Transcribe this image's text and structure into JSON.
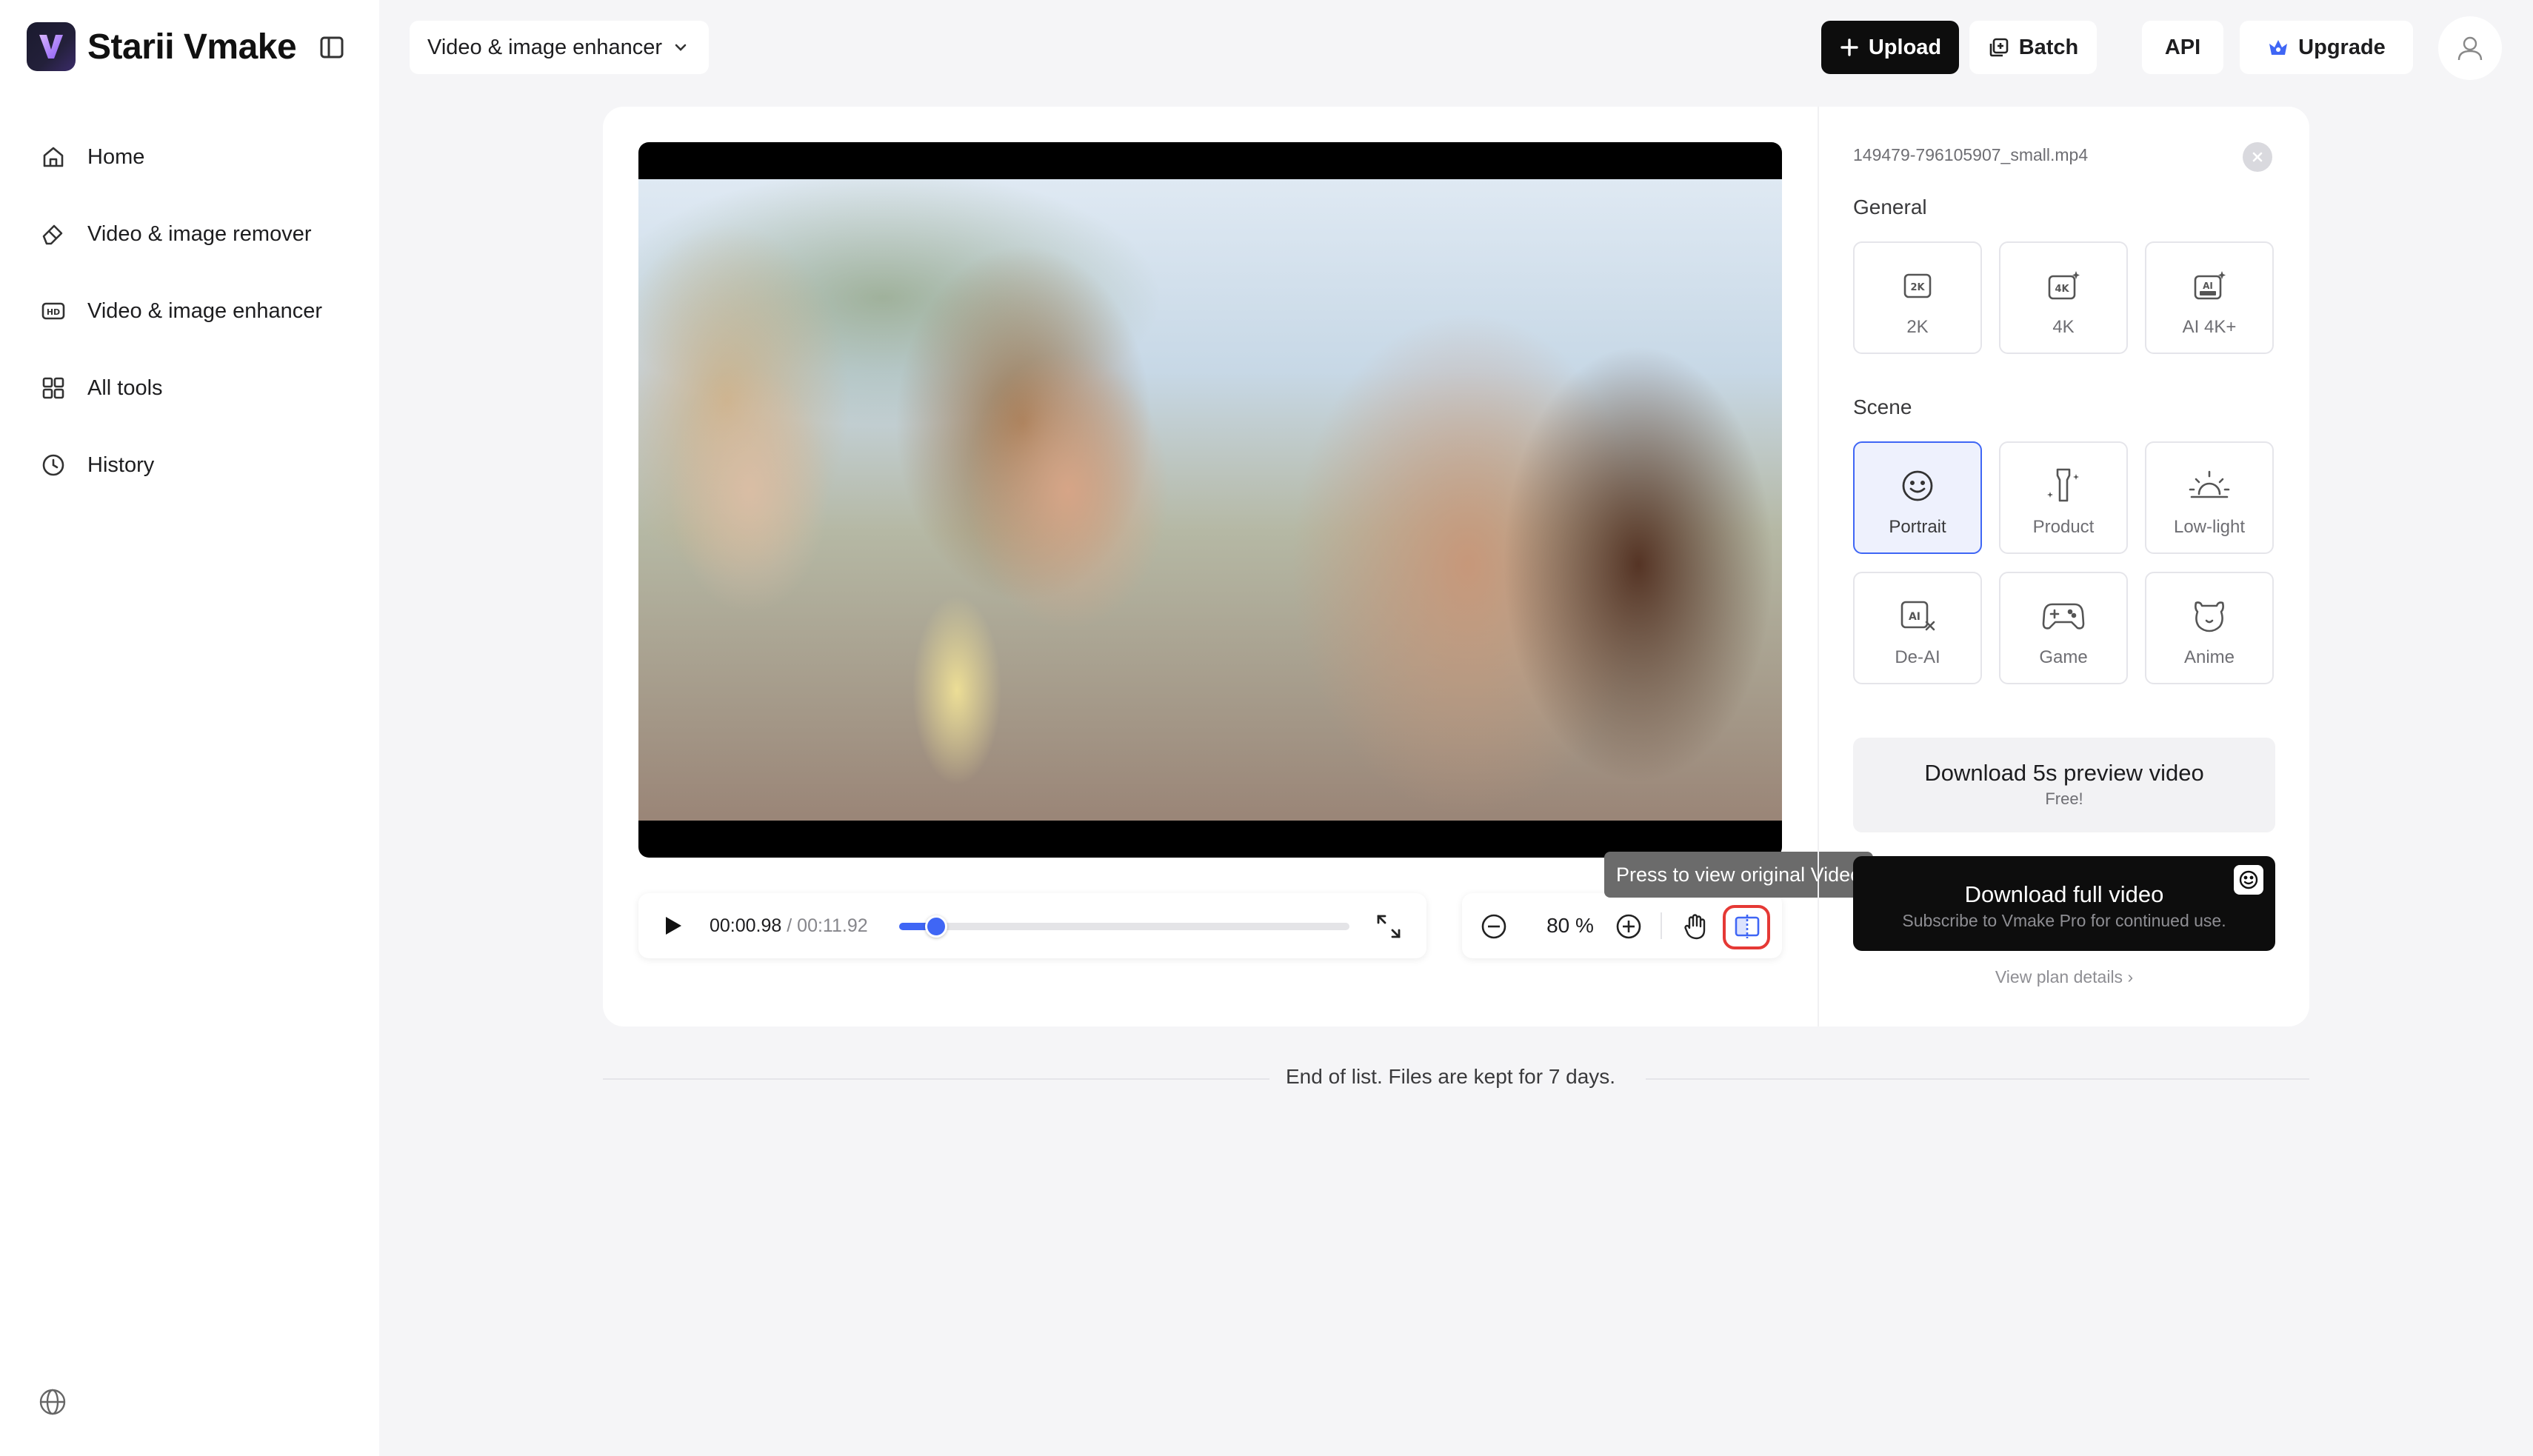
{
  "app": {
    "name": "Starii Vmake"
  },
  "sidebar": {
    "items": [
      {
        "label": "Home",
        "icon": "home-icon"
      },
      {
        "label": "Video & image remover",
        "icon": "eraser-icon"
      },
      {
        "label": "Video & image enhancer",
        "icon": "hd-icon"
      },
      {
        "label": "All tools",
        "icon": "grid-icon"
      },
      {
        "label": "History",
        "icon": "clock-icon"
      }
    ]
  },
  "header": {
    "tool_select": "Video & image enhancer",
    "upload_label": "Upload",
    "batch_label": "Batch",
    "api_label": "API",
    "upgrade_label": "Upgrade"
  },
  "player": {
    "current_time": "00:00.98",
    "total_time": "/ 00:11.92",
    "progress": 0.082,
    "zoom": "80 %"
  },
  "tooltip": "Press to view original Video",
  "panel": {
    "filename": "149479-796105907_small.mp4",
    "general_title": "General",
    "general_options": [
      {
        "label": "2K",
        "icon": "2k-icon"
      },
      {
        "label": "4K",
        "icon": "4k-icon"
      },
      {
        "label": "AI 4K+",
        "icon": "ai-4k-ultra-icon"
      }
    ],
    "scene_title": "Scene",
    "scene_options": [
      {
        "label": "Portrait",
        "icon": "smiley-icon",
        "selected": true
      },
      {
        "label": "Product",
        "icon": "bottle-sparkle-icon"
      },
      {
        "label": "Low-light",
        "icon": "sunrise-icon"
      },
      {
        "label": "De-AI",
        "icon": "ai-cross-icon"
      },
      {
        "label": "Game",
        "icon": "gamepad-icon"
      },
      {
        "label": "Anime",
        "icon": "bear-icon"
      }
    ],
    "download_preview": {
      "title": "Download 5s preview video",
      "sub": "Free!"
    },
    "download_full": {
      "title": "Download full video",
      "sub": "Subscribe to Vmake Pro for continued use."
    },
    "plan_link": "View plan details"
  },
  "footer_note": "End of list. Files are kept for 7 days.",
  "colors": {
    "accent": "#3f66f5",
    "highlight_ring": "#e53935",
    "dark_button": "#0d0d0d"
  }
}
